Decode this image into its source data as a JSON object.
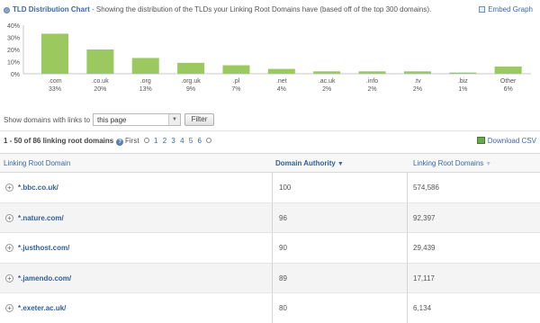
{
  "header": {
    "title_bold": "TLD Distribution Chart",
    "title_rest": " - Showing the distribution of the TLDs your Linking Root Domains have (based off of the top 300 domains).",
    "embed_label": "Embed Graph"
  },
  "chart_data": {
    "type": "bar",
    "categories": [
      ".com",
      ".co.uk",
      ".org",
      ".org.uk",
      ".pl",
      ".net",
      ".ac.uk",
      ".info",
      ".tv",
      ".biz",
      "Other"
    ],
    "category_labels": [
      "33%",
      "20%",
      "13%",
      "9%",
      "7%",
      "4%",
      "2%",
      "2%",
      "2%",
      "1%",
      "6%"
    ],
    "values": [
      33,
      20,
      13,
      9,
      7,
      4,
      2,
      2,
      2,
      1,
      6
    ],
    "yticks": [
      "40%",
      "30%",
      "20%",
      "10%",
      "0%"
    ],
    "ylim": [
      0,
      40
    ],
    "bar_color": "#9bc95f",
    "grid": false
  },
  "filter": {
    "label": "Show domains with links to",
    "selected": "this page",
    "button": "Filter"
  },
  "pager": {
    "count_text": "1 - 50 of 86 linking root domains",
    "first_label": "First",
    "pages": [
      "1",
      "2",
      "3",
      "4",
      "5",
      "6"
    ],
    "download_label": "Download CSV"
  },
  "table": {
    "headers": {
      "domain": "Linking Root Domain",
      "da": "Domain Authority",
      "lrd": "Linking Root Domains"
    },
    "rows": [
      {
        "domain": "*.bbc.co.uk/",
        "da": "100",
        "lrd": "574,586"
      },
      {
        "domain": "*.nature.com/",
        "da": "96",
        "lrd": "92,397"
      },
      {
        "domain": "*.justhost.com/",
        "da": "90",
        "lrd": "29,439"
      },
      {
        "domain": "*.jamendo.com/",
        "da": "89",
        "lrd": "17,117"
      },
      {
        "domain": "*.exeter.ac.uk/",
        "da": "80",
        "lrd": "6,134"
      }
    ]
  },
  "colors": {
    "link": "#3a6aa6",
    "bar": "#9bc95f"
  }
}
